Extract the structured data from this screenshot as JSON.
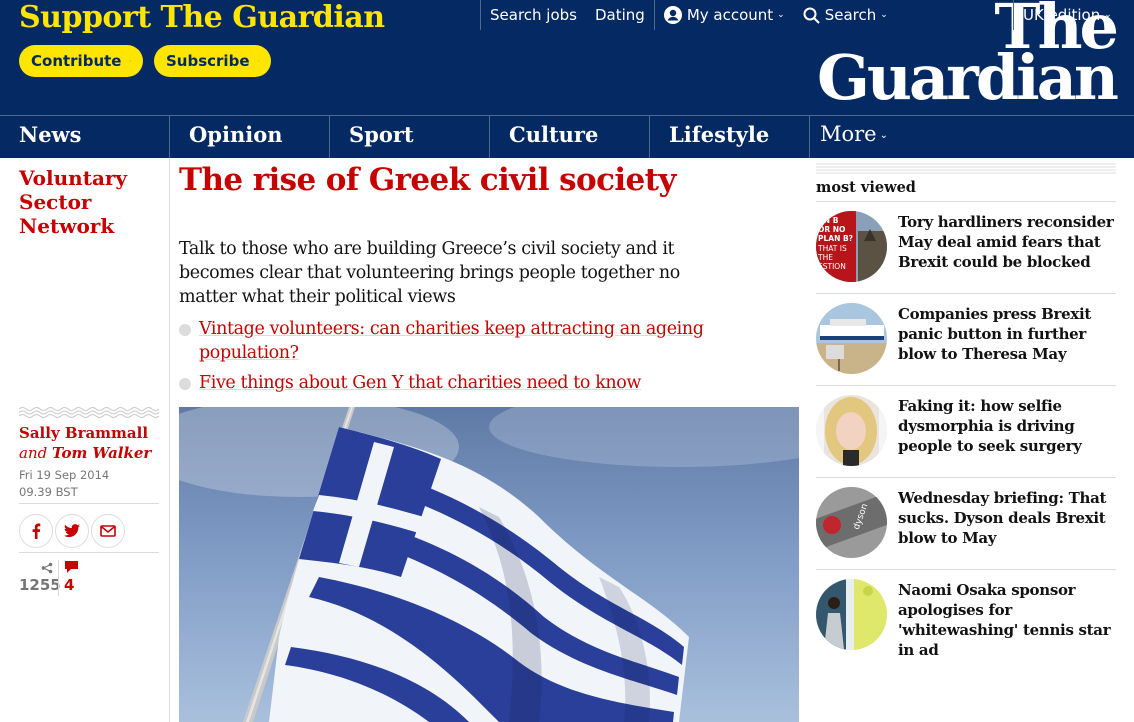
{
  "header": {
    "support_title": "Support The Guardian",
    "contribute_label": "Contribute",
    "subscribe_label": "Subscribe",
    "search_jobs": "Search jobs",
    "dating": "Dating",
    "my_account": "My account",
    "search": "Search",
    "edition": "UK edition",
    "logo_line1": "The",
    "logo_line2": "Guardian",
    "brand_color": "#052962",
    "accent_color": "#ffe500"
  },
  "pillars": [
    "News",
    "Opinion",
    "Sport",
    "Culture",
    "Lifestyle",
    "More"
  ],
  "article": {
    "section": "Voluntary Sector Network",
    "headline": "The rise of Greek civil society",
    "standfirst": "Talk to those who are building Greece’s civil society and it becomes clear that volunteering brings people together no matter what their political views",
    "related": [
      "Vintage volunteers: can charities keep attracting an ageing population?",
      "Five things about Gen Y that charities need to know"
    ],
    "author1": "Sally Brammall",
    "author_conj": "and",
    "author2": "Tom Walker",
    "date": "Fri 19 Sep 2014",
    "time": "09.39 BST",
    "share_count": "1255",
    "comment_count": "4",
    "accent_color": "#c70000"
  },
  "most_viewed": {
    "title": "most viewed",
    "items": [
      {
        "title": "Tory hardliners reconsider May deal amid fears that Brexit could be blocked",
        "thumb_text": [
          "AN B",
          "OR NO",
          "PLAN B?",
          "THAT IS",
          "THE",
          "ESTION"
        ]
      },
      {
        "title": "Companies press Brexit panic button in further blow to Theresa May"
      },
      {
        "title": "Faking it: how selfie dysmorphia is driving people to seek surgery"
      },
      {
        "title": "Wednesday briefing: That sucks. Dyson deals Brexit blow to May",
        "thumb_text": [
          "dyson"
        ]
      },
      {
        "title": "Naomi Osaka sponsor apologises for 'whitewashing' tennis star in ad"
      }
    ]
  }
}
